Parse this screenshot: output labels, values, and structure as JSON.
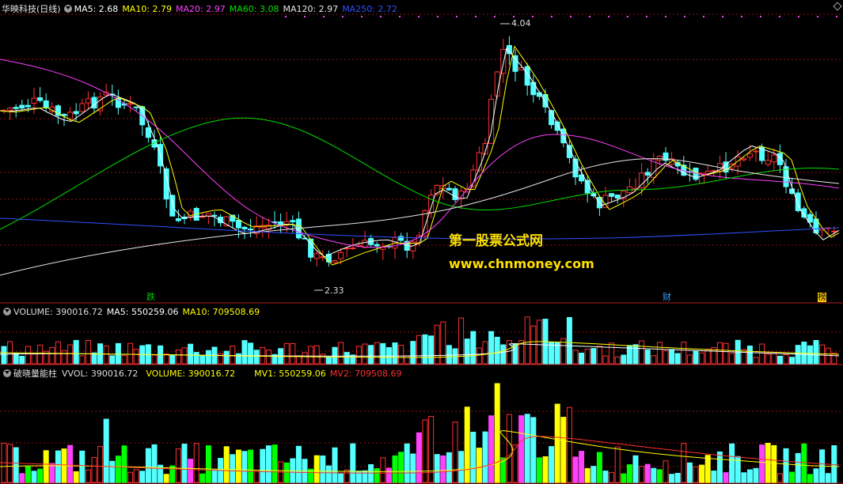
{
  "stock": {
    "name_period": "华映科技(日线)",
    "ma": [
      {
        "label": "MA5: 2.68",
        "color": "#ffffff"
      },
      {
        "label": "MA10: 2.79",
        "color": "#ffff00"
      },
      {
        "label": "MA20: 2.97",
        "color": "#ff40ff"
      },
      {
        "label": "MA60: 3.08",
        "color": "#00e000"
      },
      {
        "label": "MA120: 2.97",
        "color": "#e6e6e6"
      },
      {
        "label": "MA250: 2.72",
        "color": "#3050ff"
      }
    ],
    "high_label": "4.04",
    "low_label": "2.33",
    "events": [
      {
        "text": "跌",
        "color": "#00d000"
      },
      {
        "text": "财",
        "color": "#3aa0ff"
      },
      {
        "text": "榜",
        "color": "#ffcc00"
      }
    ]
  },
  "volume_panel": {
    "items": [
      {
        "label": "VOLUME: 390016.72",
        "color": "#dddddd"
      },
      {
        "label": "MA5: 550259.06",
        "color": "#ffffff"
      },
      {
        "label": "MA10: 709508.69",
        "color": "#ffff00"
      }
    ]
  },
  "indicator_panel": {
    "items": [
      {
        "label": "破晓量能柱",
        "color": "#dddddd"
      },
      {
        "label": "VVOL: 390016.72",
        "color": "#dddddd"
      },
      {
        "label": "VOLUME: 390016.72",
        "color": "#ffff00"
      },
      {
        "label": "MV1: 550259.06",
        "color": "#ffff00"
      },
      {
        "label": "MV2: 709508.69",
        "color": "#ff3030"
      }
    ]
  },
  "watermark": {
    "line1": "第一股票公式网",
    "line2": "www.chnmoney.com"
  },
  "colors": {
    "up": "#ff3030",
    "down": "#54ffff",
    "grid": "#8b1010",
    "panel_border": "#b02020"
  }
}
